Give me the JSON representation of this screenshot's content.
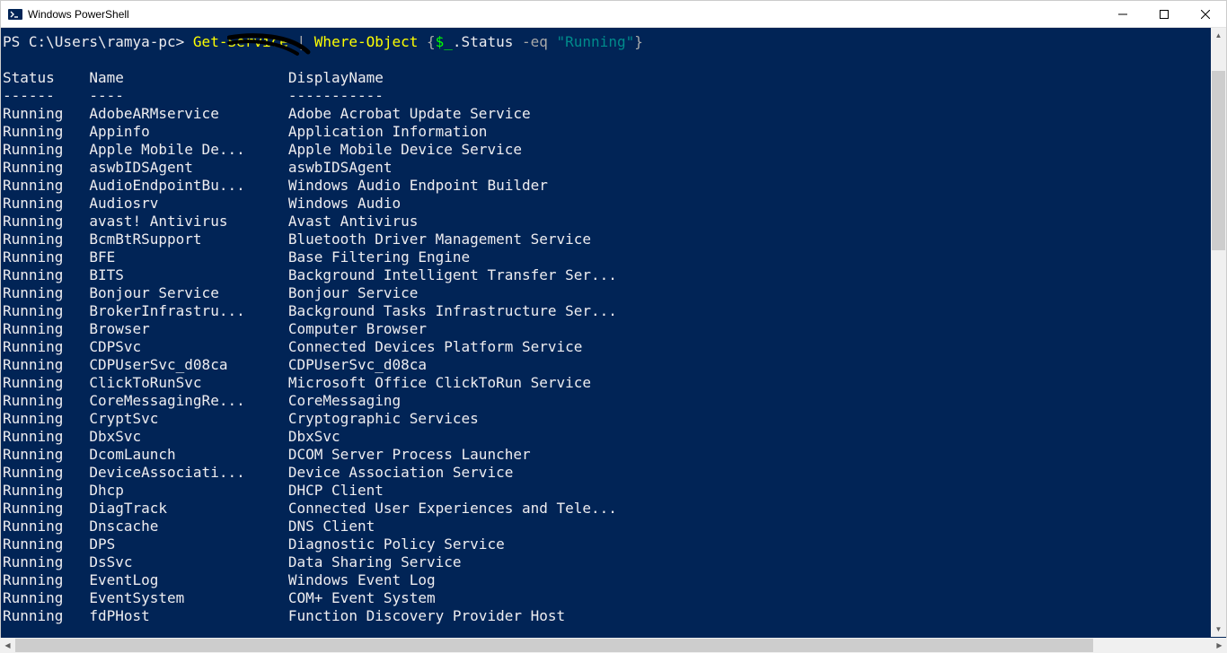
{
  "window": {
    "title": "Windows PowerShell"
  },
  "prompt": {
    "ps": "PS C:\\Users\\ramya-pc> ",
    "cmd1": "Get-Service",
    "sep1": " | ",
    "cmd2": "Where-Object",
    "brace_open": " {",
    "var": "$_",
    "member": ".Status ",
    "param": "-eq ",
    "str": "\"Running\"",
    "brace_close": "}"
  },
  "headers": {
    "status": "Status",
    "name": "Name",
    "display": "DisplayName",
    "u1": "------",
    "u2": "----",
    "u3": "-----------"
  },
  "col_widths": {
    "status": 10,
    "name": 23
  },
  "services": [
    {
      "status": "Running",
      "name": "AdobeARMservice",
      "display": "Adobe Acrobat Update Service"
    },
    {
      "status": "Running",
      "name": "Appinfo",
      "display": "Application Information"
    },
    {
      "status": "Running",
      "name": "Apple Mobile De...",
      "display": "Apple Mobile Device Service"
    },
    {
      "status": "Running",
      "name": "aswbIDSAgent",
      "display": "aswbIDSAgent"
    },
    {
      "status": "Running",
      "name": "AudioEndpointBu...",
      "display": "Windows Audio Endpoint Builder"
    },
    {
      "status": "Running",
      "name": "Audiosrv",
      "display": "Windows Audio"
    },
    {
      "status": "Running",
      "name": "avast! Antivirus",
      "display": "Avast Antivirus"
    },
    {
      "status": "Running",
      "name": "BcmBtRSupport",
      "display": "Bluetooth Driver Management Service"
    },
    {
      "status": "Running",
      "name": "BFE",
      "display": "Base Filtering Engine"
    },
    {
      "status": "Running",
      "name": "BITS",
      "display": "Background Intelligent Transfer Ser..."
    },
    {
      "status": "Running",
      "name": "Bonjour Service",
      "display": "Bonjour Service"
    },
    {
      "status": "Running",
      "name": "BrokerInfrastru...",
      "display": "Background Tasks Infrastructure Ser..."
    },
    {
      "status": "Running",
      "name": "Browser",
      "display": "Computer Browser"
    },
    {
      "status": "Running",
      "name": "CDPSvc",
      "display": "Connected Devices Platform Service"
    },
    {
      "status": "Running",
      "name": "CDPUserSvc_d08ca",
      "display": "CDPUserSvc_d08ca"
    },
    {
      "status": "Running",
      "name": "ClickToRunSvc",
      "display": "Microsoft Office ClickToRun Service"
    },
    {
      "status": "Running",
      "name": "CoreMessagingRe...",
      "display": "CoreMessaging"
    },
    {
      "status": "Running",
      "name": "CryptSvc",
      "display": "Cryptographic Services"
    },
    {
      "status": "Running",
      "name": "DbxSvc",
      "display": "DbxSvc"
    },
    {
      "status": "Running",
      "name": "DcomLaunch",
      "display": "DCOM Server Process Launcher"
    },
    {
      "status": "Running",
      "name": "DeviceAssociati...",
      "display": "Device Association Service"
    },
    {
      "status": "Running",
      "name": "Dhcp",
      "display": "DHCP Client"
    },
    {
      "status": "Running",
      "name": "DiagTrack",
      "display": "Connected User Experiences and Tele..."
    },
    {
      "status": "Running",
      "name": "Dnscache",
      "display": "DNS Client"
    },
    {
      "status": "Running",
      "name": "DPS",
      "display": "Diagnostic Policy Service"
    },
    {
      "status": "Running",
      "name": "DsSvc",
      "display": "Data Sharing Service"
    },
    {
      "status": "Running",
      "name": "EventLog",
      "display": "Windows Event Log"
    },
    {
      "status": "Running",
      "name": "EventSystem",
      "display": "COM+ Event System"
    },
    {
      "status": "Running",
      "name": "fdPHost",
      "display": "Function Discovery Provider Host"
    }
  ]
}
